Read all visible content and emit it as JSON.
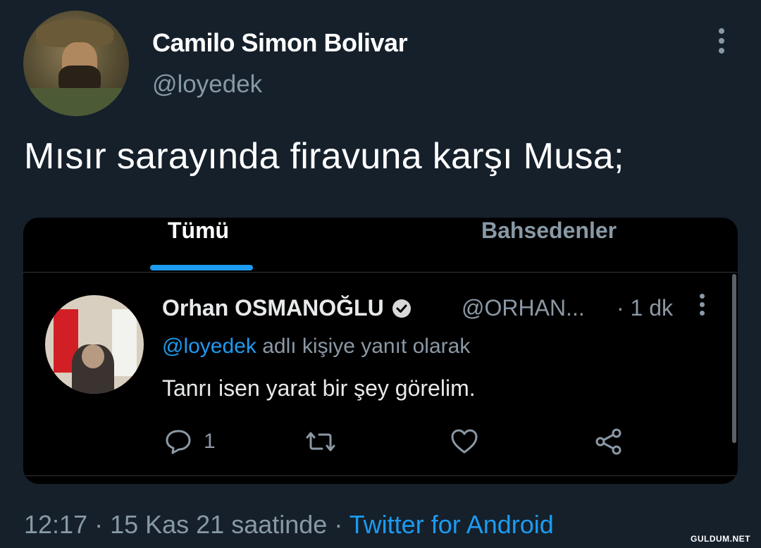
{
  "tweet": {
    "display_name": "Camilo Simon Bolivar",
    "handle": "@loyedek",
    "text": "Mısır sarayında firavuna karşı Musa;",
    "footer_time": "12:17 · 15 Kas 21 saatinde ·",
    "footer_source": "Twitter for Android"
  },
  "embedded": {
    "tabs": [
      {
        "label": "Tümü",
        "active": true
      },
      {
        "label": "Bahsedenler",
        "active": false
      }
    ],
    "reply": {
      "name": "Orhan OSMANOĞLU",
      "handle": "@ORHAN...",
      "time": "· 1 dk",
      "reply_to_mention": "@loyedek",
      "reply_to_suffix": " adlı kişiye yanıt olarak",
      "text": "Tanrı isen yarat bir şey görelim.",
      "reply_count": "1",
      "icons": [
        "reply-icon",
        "retweet-icon",
        "like-icon",
        "share-icon"
      ]
    }
  },
  "watermark": "GULDUM.NET",
  "colors": {
    "background": "#15202b",
    "card": "#000000",
    "accent": "#1d9bf0",
    "secondary_text": "#8899a6"
  }
}
